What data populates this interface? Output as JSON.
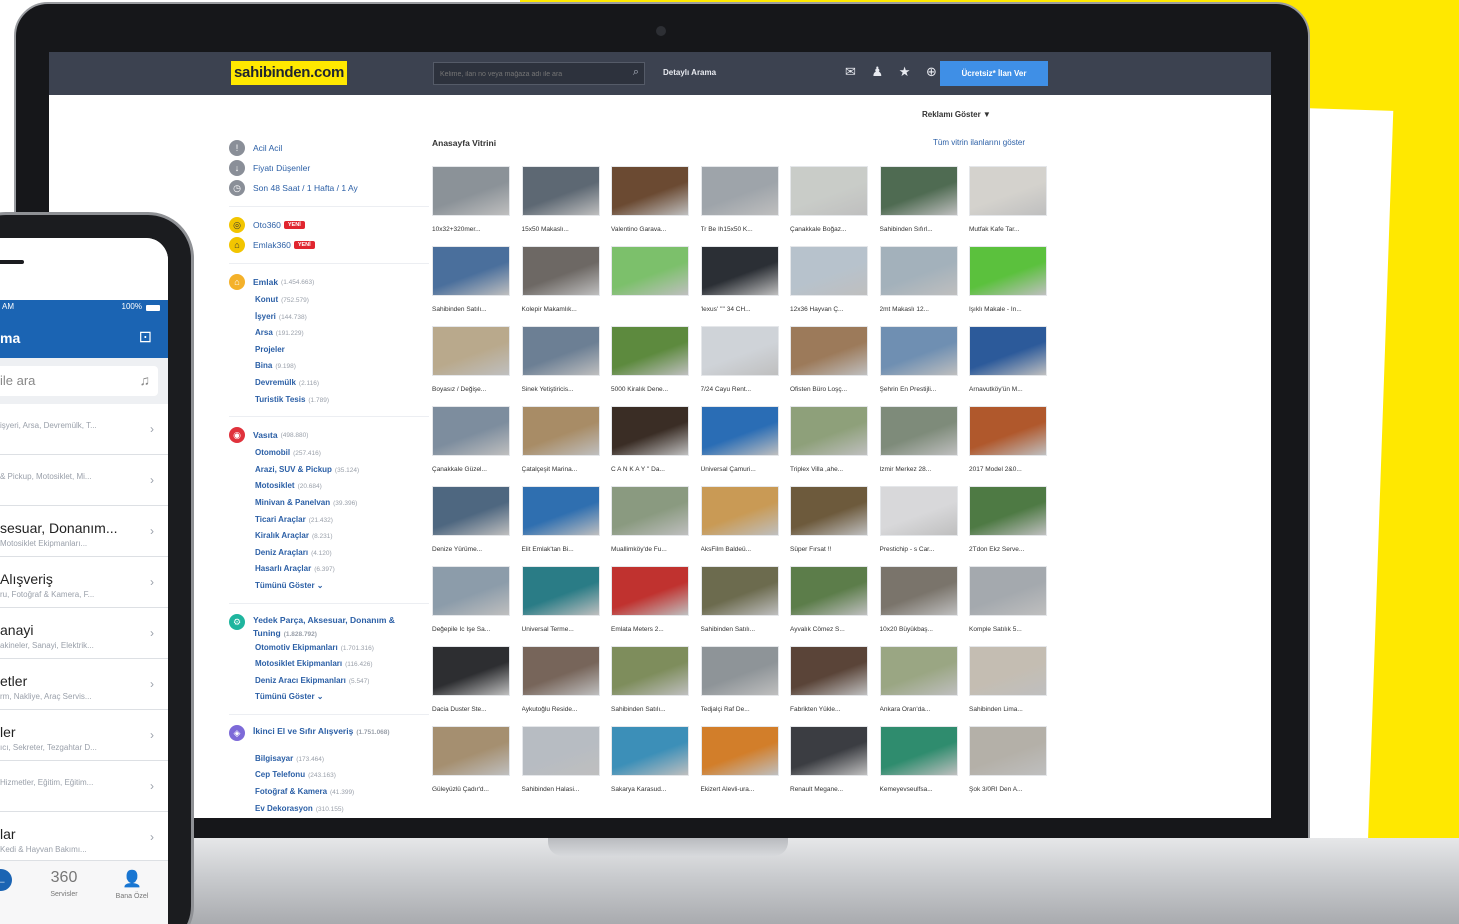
{
  "site": {
    "logo": "sahibinden.com",
    "search_placeholder": "Kelime, ilan no veya mağaza adı ile ara",
    "advanced_search": "Detaylı Arama",
    "post_ad": "Ücretsiz* İlan Ver",
    "header_icons": "✉ ♟ ★ ⊕",
    "ad_toggle": "Reklamı Göster ▼"
  },
  "sidebar": {
    "quick": [
      "Acil Acil",
      "Fiyatı Düşenler",
      "Son 48 Saat / 1 Hafta / 1 Ay"
    ],
    "apps": [
      {
        "label": "Oto360",
        "badge": "YENİ"
      },
      {
        "label": "Emlak360",
        "badge": "YENİ"
      }
    ],
    "emlak": {
      "title": "Emlak",
      "count": "(1.454.663)",
      "items": [
        {
          "label": "Konut",
          "count": "(752.579)"
        },
        {
          "label": "İşyeri",
          "count": "(144.738)"
        },
        {
          "label": "Arsa",
          "count": "(191.229)"
        },
        {
          "label": "Projeler",
          "count": ""
        },
        {
          "label": "Bina",
          "count": "(9.198)"
        },
        {
          "label": "Devremülk",
          "count": "(2.116)"
        },
        {
          "label": "Turistik Tesis",
          "count": "(1.789)"
        }
      ]
    },
    "vasita": {
      "title": "Vasıta",
      "count": "(498.880)",
      "items": [
        {
          "label": "Otomobil",
          "count": "(257.416)"
        },
        {
          "label": "Arazi, SUV & Pickup",
          "count": "(35.124)"
        },
        {
          "label": "Motosiklet",
          "count": "(20.684)"
        },
        {
          "label": "Minivan & Panelvan",
          "count": "(39.396)"
        },
        {
          "label": "Ticari Araçlar",
          "count": "(21.432)"
        },
        {
          "label": "Kiralık Araçlar",
          "count": "(8.231)"
        },
        {
          "label": "Deniz Araçları",
          "count": "(4.120)"
        },
        {
          "label": "Hasarlı Araçlar",
          "count": "(6.397)"
        },
        {
          "label": "Tümünü Göster ⌄",
          "count": ""
        }
      ]
    },
    "yedek": {
      "title": "Yedek Parça, Aksesuar, Donanım & Tuning",
      "count": "(1.828.792)",
      "items": [
        {
          "label": "Otomotiv Ekipmanları",
          "count": "(1.701.316)"
        },
        {
          "label": "Motosiklet Ekipmanları",
          "count": "(116.426)"
        },
        {
          "label": "Deniz Aracı Ekipmanları",
          "count": "(5.547)"
        },
        {
          "label": "Tümünü Göster ⌄",
          "count": ""
        }
      ]
    },
    "ikinci": {
      "title": "İkinci El ve Sıfır Alışveriş",
      "count": "(1.751.068)",
      "items": [
        {
          "label": "Bilgisayar",
          "count": "(173.464)"
        },
        {
          "label": "Cep Telefonu",
          "count": "(243.163)"
        },
        {
          "label": "Fotoğraf & Kamera",
          "count": "(41.399)"
        },
        {
          "label": "Ev Dekorasyon",
          "count": "(310.155)"
        }
      ]
    }
  },
  "showcase": {
    "title": "Anasayfa Vitrini",
    "view_all": "Tüm vitrin ilanlarını göster",
    "items": [
      {
        "caption": "10x32+320mer...",
        "color": "#8b9298"
      },
      {
        "caption": "15x50 Makaslı...",
        "color": "#5d6873"
      },
      {
        "caption": "Valentino Garava...",
        "color": "#6b4a32"
      },
      {
        "caption": "Tr Be Ih15x50 K...",
        "color": "#9ea4aa"
      },
      {
        "caption": "Çanakkale Boğaz...",
        "color": "#c9ccc8"
      },
      {
        "caption": "Sahibinden Sıfırl...",
        "color": "#4f6b52"
      },
      {
        "caption": "Mutfak Kafe Tar...",
        "color": "#d4d2cd"
      },
      {
        "caption": "Sahibinden Satılı...",
        "color": "#4a6f9c"
      },
      {
        "caption": "Kolepir Makamlık...",
        "color": "#6d6864"
      },
      {
        "caption": "",
        "color": "#7cc06b"
      },
      {
        "caption": "'lexus' '''' 34 CH...",
        "color": "#2b2f35"
      },
      {
        "caption": "12x36 Hayvan Ç...",
        "color": "#b7c2cc"
      },
      {
        "caption": "2mt Makaslı 12...",
        "color": "#a3b1bb"
      },
      {
        "caption": "Işıklı Makale - In...",
        "color": "#5bc13d"
      },
      {
        "caption": "Boyasız / Değişe...",
        "color": "#b9a98c"
      },
      {
        "caption": "Sinek Yetiştiricis...",
        "color": "#6c7f94"
      },
      {
        "caption": "5000 Kiralık Dene...",
        "color": "#5d8a3e"
      },
      {
        "caption": "7/24 Cayu Rent...",
        "color": "#cfd3d8"
      },
      {
        "caption": "Ofisten Büro Loşç...",
        "color": "#9c7a5a"
      },
      {
        "caption": "Şehrin En Prestijli...",
        "color": "#6f8fb2"
      },
      {
        "caption": "Arnavutköy'ün M...",
        "color": "#2c5a9a"
      },
      {
        "caption": "Çanakkale Güzel...",
        "color": "#7d8d9e"
      },
      {
        "caption": "Çatalçeşit Marina...",
        "color": "#a88c66"
      },
      {
        "caption": "C A N K A Y '' Da...",
        "color": "#3a2d25"
      },
      {
        "caption": "Üniversal Çamuri...",
        "color": "#2a6db5"
      },
      {
        "caption": "Triplex Villa ,ahe...",
        "color": "#8ea07a"
      },
      {
        "caption": "Izmir Merkez 28...",
        "color": "#7e8b7a"
      },
      {
        "caption": "2017 Model 2&0...",
        "color": "#b0582c"
      },
      {
        "caption": "Denize Yürüme...",
        "color": "#4e6780"
      },
      {
        "caption": "Elit Emlak'tan Bi...",
        "color": "#2f6fb0"
      },
      {
        "caption": "Muallimköy'de Fu...",
        "color": "#8a9a80"
      },
      {
        "caption": "AksFilm Baldeü...",
        "color": "#c99a55"
      },
      {
        "caption": "Süper Fırsat !!",
        "color": "#6d5a3c"
      },
      {
        "caption": "Prestichip - s Car...",
        "color": "#d8d8da"
      },
      {
        "caption": "2Tdon Ekz Serve...",
        "color": "#4e7a44"
      },
      {
        "caption": "Değepile İc Işe Sa...",
        "color": "#8c9caa"
      },
      {
        "caption": "Universal Terme...",
        "color": "#2a7c86"
      },
      {
        "caption": "Emlata Meters 2...",
        "color": "#c0322f"
      },
      {
        "caption": "Sahibinden Satılı...",
        "color": "#6c6b4e"
      },
      {
        "caption": "Ayvalık Cömez S...",
        "color": "#5c7d4a"
      },
      {
        "caption": "10x20 Büyükbaş...",
        "color": "#7a746b"
      },
      {
        "caption": "Komple Satılık 5...",
        "color": "#a4a9ae"
      },
      {
        "caption": "Dacia Duster Ste...",
        "color": "#2d2e31"
      },
      {
        "caption": "Aykutoğlu Reside...",
        "color": "#77655a"
      },
      {
        "caption": "Sahibinden Satılı...",
        "color": "#7e8d5c"
      },
      {
        "caption": "Tedjalçi Raf De...",
        "color": "#8e9498"
      },
      {
        "caption": "Fabrikten Yükle...",
        "color": "#5a4438"
      },
      {
        "caption": "Ankara Oran'da...",
        "color": "#9aa683"
      },
      {
        "caption": "Sahibinden Lima...",
        "color": "#c4bdb2"
      },
      {
        "caption": "Güleyüzlü Çadır'd...",
        "color": "#a58f70"
      },
      {
        "caption": "Sahibinden Halasi...",
        "color": "#b7bcc2"
      },
      {
        "caption": "Sakarya Karasud...",
        "color": "#3c8fb8"
      },
      {
        "caption": "Ekizert Alevli-ura...",
        "color": "#d27e2a"
      },
      {
        "caption": "Renault Megane...",
        "color": "#3b3d42"
      },
      {
        "caption": "Kemeyevseulfsa...",
        "color": "#2f8c6e"
      },
      {
        "caption": "Şok 3/0RI Den A...",
        "color": "#b4b0a8"
      }
    ]
  },
  "phone": {
    "time": "AM",
    "battery": "100%",
    "title": "ma",
    "search_placeholder": "ile ara",
    "items": [
      {
        "title": "",
        "sub": "işyeri, Arsa, Devremülk, T..."
      },
      {
        "title": "",
        "sub": "& Pickup, Motosiklet, Mi..."
      },
      {
        "title": "sesuar, Donanım...",
        "sub": "Motosiklet Ekipmanları..."
      },
      {
        "title": "Alışveriş",
        "sub": "ru, Fotoğraf & Kamera, F..."
      },
      {
        "title": "anayi",
        "sub": "akineler, Sanayi, Elektrik..."
      },
      {
        "title": "etler",
        "sub": "rm, Nakliye, Araç Servis..."
      },
      {
        "title": "ler",
        "sub": "ıcı, Sekreter, Tezgahtar D..."
      },
      {
        "title": "",
        "sub": "Hizmetler, Eğitim, Eğitim..."
      },
      {
        "title": "lar",
        "sub": "Kedi & Hayvan Bakımı..."
      }
    ],
    "tabs": [
      {
        "label": "",
        "icon": "←"
      },
      {
        "label": "Servisler",
        "icon": "360"
      },
      {
        "label": "Bana Özel",
        "icon": "👤"
      }
    ]
  }
}
